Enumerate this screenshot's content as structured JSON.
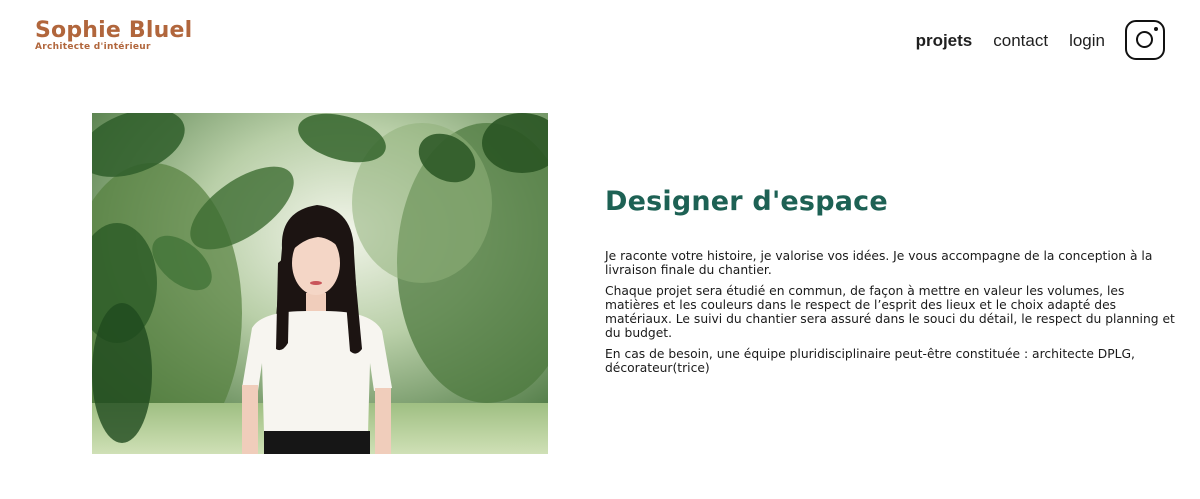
{
  "header": {
    "logo": {
      "name": "Sophie Bluel",
      "subtitle": "Architecte d'intérieur"
    },
    "nav": [
      {
        "label": "projets",
        "active": true
      },
      {
        "label": "contact",
        "active": false
      },
      {
        "label": "login",
        "active": false
      }
    ],
    "social_icon": "instagram-icon"
  },
  "introduction": {
    "photo_alt": "portrait photo",
    "title": "Designer d'espace",
    "paragraphs": [
      "Je raconte votre histoire, je valorise vos idées. Je vous accompagne de la conception à la livraison finale du chantier.",
      "Chaque projet sera étudié en commun, de façon à mettre en valeur les volumes, les matières et les couleurs dans le respect de l’esprit des lieux et le choix adapté des matériaux. Le suivi du chantier sera assuré dans le souci du détail, le respect du planning et du budget.",
      "En cas de besoin, une équipe pluridisciplinaire peut-être constituée : architecte DPLG, décorateur(trice)"
    ]
  },
  "colors": {
    "brand": "#B1663C",
    "heading": "#1D6154",
    "text": "#1a1a1a"
  }
}
